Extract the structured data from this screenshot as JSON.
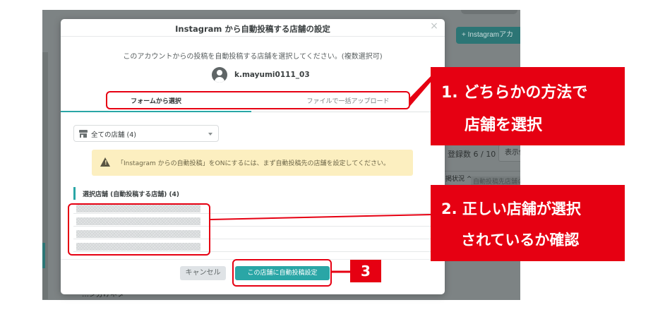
{
  "background": {
    "add_button": "+ Instagramアカ",
    "count_text": "登録数 6 / 10",
    "view_button": "表示件",
    "status_col": "掲状況 ^",
    "status_col2": "自動投稿先店舗の設定",
    "footer_text": "…ジ分けネタ"
  },
  "modal": {
    "title": "Instagram から自動投稿する店舗の設定",
    "close_label": "×",
    "instruction": "このアカウントからの投稿を自動投稿する店舗を選択してください。(複数選択可)",
    "account_name": "k.mayumi0111_03",
    "tabs": [
      {
        "label": "フォームから選択",
        "active": true
      },
      {
        "label": "ファイルで一括アップロード",
        "active": false
      }
    ],
    "store_select": {
      "value": "全ての店舗 (4)"
    },
    "warning": {
      "icon_mark": "!",
      "text": "「Instagram からの自動投稿」をONにするには、まず自動投稿先の店舗を設定してください。"
    },
    "selected_section": {
      "title": "選択店舗 (自動投稿する店舗)",
      "count": "(4)"
    },
    "selected_rows": 4,
    "cancel_label": "キャンセル",
    "submit_label": "この店舗に自動投稿設定"
  },
  "annotations": {
    "step1_line1": "1. どちらかの方法で",
    "step1_line2": "店舗を選択",
    "step2_line1": "2. 正しい店舗が選択",
    "step2_line2": "されているか確認",
    "step3": "3"
  },
  "colors": {
    "accent": "#2aa6a6",
    "annotation_red": "#e60012",
    "warning_bg": "#fcefc0"
  },
  "icons": [
    "close-icon",
    "avatar-icon",
    "store-icon",
    "chevron-down-icon",
    "warning-icon"
  ]
}
